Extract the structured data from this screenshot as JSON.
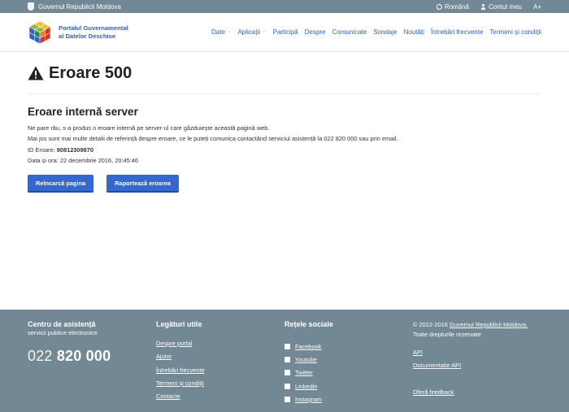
{
  "topbar": {
    "gov_label": "Guvernul Republicii Moldova",
    "language": "Română",
    "account": "Contul meu",
    "font_size": "A+"
  },
  "header": {
    "brand_line1": "Portalul Guvernamental",
    "brand_line2": "al Datelor Deschise",
    "nav": [
      {
        "label": "Date",
        "dropdown": true
      },
      {
        "label": "Aplicații",
        "dropdown": true
      },
      {
        "label": "Participă",
        "dropdown": false
      },
      {
        "label": "Despre",
        "dropdown": false
      },
      {
        "label": "Comunicate",
        "dropdown": false
      },
      {
        "label": "Sondaje",
        "dropdown": false
      },
      {
        "label": "Noutăți",
        "dropdown": false
      },
      {
        "label": "Întrebări frecvente",
        "dropdown": false
      },
      {
        "label": "Termeni și condiții",
        "dropdown": false
      }
    ]
  },
  "main": {
    "title": "Eroare 500",
    "subtitle": "Eroare internă server",
    "line1": "Ne pare rău, s-a produs o eroare internă pe server-ul care găzduiește această pagină web.",
    "line2": "Mai jos sunt mai multe detalii de referință despre eroare, ce le puteți comunica contactând serviciul asistență la 022 820 000 sau prin email.",
    "error_id_label": "ID Eroare:",
    "error_id": "90812309870",
    "datetime_label": "Data și ora:",
    "datetime": "22 decembrie 2016, 20:45:46",
    "reload_button": "Reîncarcă pagina",
    "report_button": "Raportează eroarea"
  },
  "footer": {
    "support_title": "Centru de asistență",
    "support_sub": "servicii publice electronice",
    "phone_prefix": "022",
    "phone_number": "820 000",
    "links_title": "Legături utile",
    "links": [
      "Despre portal",
      "Ajutor",
      "Întrebări frecvente",
      "Termeni și condiții",
      "Contacte"
    ],
    "social_title": "Rețele sociale",
    "social": [
      {
        "label": "Facebook",
        "icon": "facebook-icon"
      },
      {
        "label": "Youtube",
        "icon": "youtube-icon"
      },
      {
        "label": "Twitter",
        "icon": "twitter-icon"
      },
      {
        "label": "Linkedin",
        "icon": "linkedin-icon"
      },
      {
        "label": "Instagram",
        "icon": "instagram-icon"
      }
    ],
    "copyright_prefix": "© 2012-2016",
    "copyright_link": "Guvernul Republicii Moldova.",
    "rights": "Toate drepturile rezervate",
    "api": "API",
    "api_docs": "Documentație API",
    "feedback": "Oferă feedback"
  }
}
